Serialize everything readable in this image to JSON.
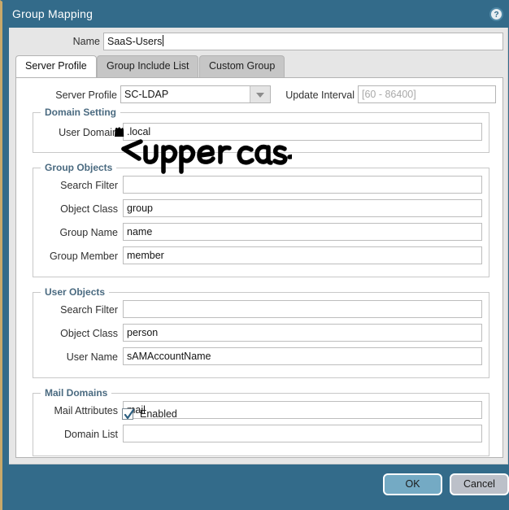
{
  "window": {
    "title": "Group Mapping",
    "help_icon": "help-circle-icon"
  },
  "name_field": {
    "label": "Name",
    "value": "SaaS-Users"
  },
  "tabs": [
    {
      "label": "Server Profile",
      "active": true
    },
    {
      "label": "Group Include List",
      "active": false
    },
    {
      "label": "Custom Group",
      "active": false
    }
  ],
  "server_profile": {
    "label": "Server Profile",
    "value": "SC-LDAP",
    "dropdown_icon": "chevron-down-icon"
  },
  "update_interval": {
    "label": "Update Interval",
    "value": "",
    "placeholder": "[60 - 86400]"
  },
  "domain_setting": {
    "title": "Domain Setting",
    "fields": [
      {
        "label": "User Domain",
        "value": ".local",
        "redacted_prefix": true
      }
    ]
  },
  "group_objects": {
    "title": "Group Objects",
    "fields": [
      {
        "label": "Search Filter",
        "value": ""
      },
      {
        "label": "Object Class",
        "value": "group"
      },
      {
        "label": "Group Name",
        "value": "name"
      },
      {
        "label": "Group Member",
        "value": "member"
      }
    ]
  },
  "user_objects": {
    "title": "User Objects",
    "fields": [
      {
        "label": "Search Filter",
        "value": ""
      },
      {
        "label": "Object Class",
        "value": "person"
      },
      {
        "label": "User Name",
        "value": "sAMAccountName"
      }
    ]
  },
  "mail_domains": {
    "title": "Mail Domains",
    "fields": [
      {
        "label": "Mail Attributes",
        "value": "mail"
      },
      {
        "label": "Domain List",
        "value": ""
      }
    ]
  },
  "enabled_checkbox": {
    "label": "Enabled",
    "checked": true
  },
  "footer": {
    "ok_label": "OK",
    "cancel_label": "Cancel"
  },
  "annotation": {
    "text": "uppercase",
    "arrow": "left-arrow",
    "color": "#000000"
  },
  "colors": {
    "titlebar": "#336b8a",
    "panel": "#e6e6e6",
    "accent_gold": "#c9a96a",
    "group_label": "#4a6a80",
    "ok_button": "#74aac4",
    "cancel_button": "#bcc0c9"
  }
}
